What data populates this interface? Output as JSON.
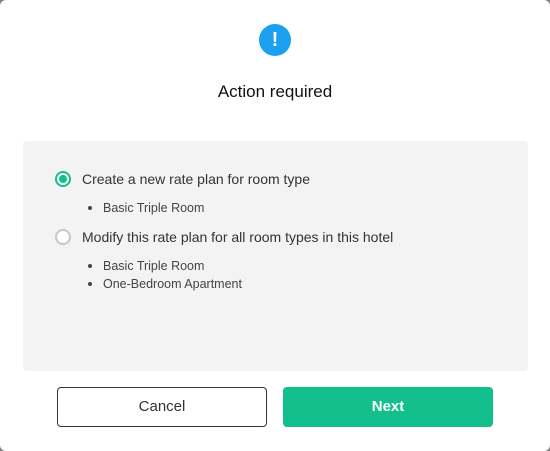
{
  "dialog": {
    "icon": "exclamation-icon",
    "icon_glyph": "!",
    "title": "Action required"
  },
  "options": [
    {
      "label": "Create a new rate plan for room type",
      "selected": true,
      "rooms": [
        "Basic Triple Room"
      ]
    },
    {
      "label": "Modify this rate plan for all room types in this hotel",
      "selected": false,
      "rooms": [
        "Basic Triple Room",
        "One-Bedroom Apartment"
      ]
    }
  ],
  "buttons": {
    "cancel_label": "Cancel",
    "next_label": "Next"
  },
  "colors": {
    "accent": "#13bf8d",
    "info_icon": "#1aa0ec",
    "panel_bg": "#f3f3f3"
  }
}
